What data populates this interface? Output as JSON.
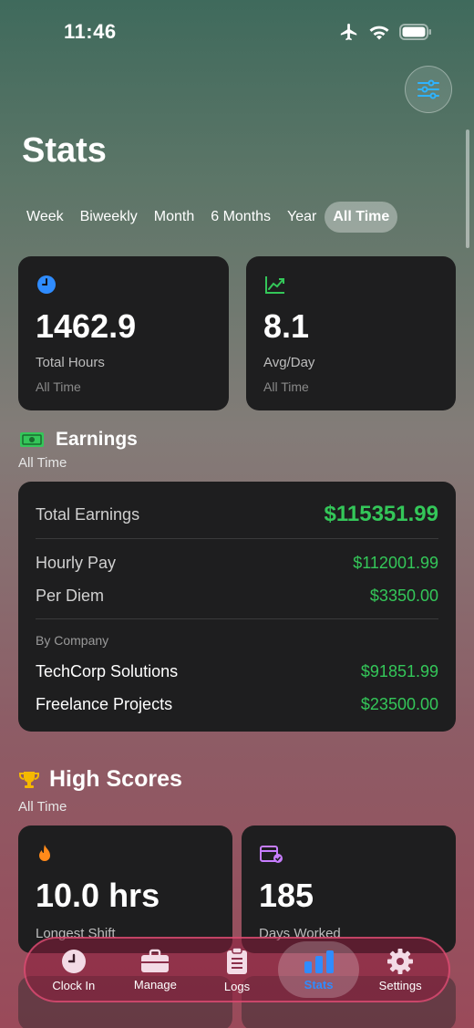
{
  "status": {
    "time": "11:46"
  },
  "page": {
    "title": "Stats"
  },
  "ranges": [
    "Week",
    "Biweekly",
    "Month",
    "6 Months",
    "Year",
    "All Time"
  ],
  "active_range": "All Time",
  "summary": {
    "total_hours": {
      "value": "1462.9",
      "label": "Total Hours",
      "period": "All Time"
    },
    "avg_day": {
      "value": "8.1",
      "label": "Avg/Day",
      "period": "All Time"
    }
  },
  "earnings": {
    "title": "Earnings",
    "period": "All Time",
    "total_label": "Total Earnings",
    "total_value": "$115351.99",
    "hourly_label": "Hourly Pay",
    "hourly_value": "$112001.99",
    "perdiem_label": "Per Diem",
    "perdiem_value": "$3350.00",
    "by_company_label": "By Company",
    "companies": [
      {
        "name": "TechCorp Solutions",
        "value": "$91851.99"
      },
      {
        "name": "Freelance Projects",
        "value": "$23500.00"
      }
    ]
  },
  "high_scores": {
    "title": "High Scores",
    "period": "All Time",
    "longest_shift": {
      "value": "10.0 hrs",
      "label": "Longest Shift"
    },
    "days_worked": {
      "value": "185",
      "label": "Days Worked"
    }
  },
  "tabs": [
    {
      "label": "Clock In",
      "icon": "clock-icon"
    },
    {
      "label": "Manage",
      "icon": "briefcase-icon"
    },
    {
      "label": "Logs",
      "icon": "clipboard-icon"
    },
    {
      "label": "Stats",
      "icon": "bar-chart-icon"
    },
    {
      "label": "Settings",
      "icon": "gear-icon"
    }
  ],
  "colors": {
    "accent_blue": "#2f8cff",
    "earnings_green": "#34c759",
    "card_bg": "#1e1e1f"
  }
}
